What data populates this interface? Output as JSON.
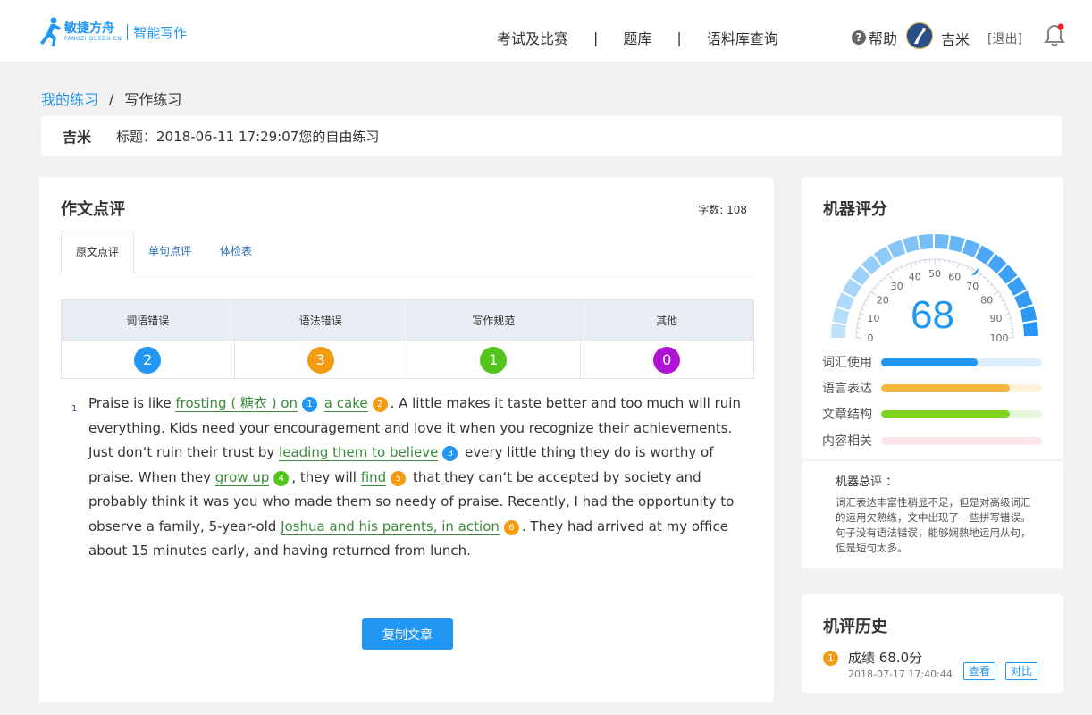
{
  "header": {
    "logo_cn": "敏捷方舟",
    "logo_en": "FANGZHOUEDU.CN",
    "product": "智能写作",
    "nav": [
      "考试及比赛",
      "题库",
      "语料库查询"
    ],
    "nav_divider": "|",
    "help": "帮助",
    "user": "吉米",
    "logout": "[退出]"
  },
  "breadcrumb": {
    "parent": "我的练习",
    "sep": "/",
    "current": "写作练习"
  },
  "title_bar": {
    "user": "吉米",
    "title": "标题：2018-06-11 17:29:07您的自由练习"
  },
  "review": {
    "heading": "作文点评",
    "word_count": "字数: 108",
    "tabs": [
      "原文点评",
      "单句点评",
      "体检表"
    ],
    "copy_button": "复制文章"
  },
  "errors": [
    {
      "label": "词语错误",
      "count": "2",
      "color": "#2196f3"
    },
    {
      "label": "语法错误",
      "count": "3",
      "color": "#f39c12"
    },
    {
      "label": "写作规范",
      "count": "1",
      "color": "#52c41a"
    },
    {
      "label": "其他",
      "count": "0",
      "color": "#b212d6"
    }
  ],
  "essay": {
    "para_num": "1",
    "segments": [
      {
        "t": "Praise is like "
      },
      {
        "t": "frosting ( 糖衣 ) on",
        "hl": true
      },
      {
        "n": "1",
        "c": "#2196f3"
      },
      {
        "t": " "
      },
      {
        "t": "a cake",
        "hl": true
      },
      {
        "n": "2",
        "c": "#f39c12"
      },
      {
        "t": ". A little makes it taste better and too much will ruin everything. Kids need your encouragement and love it when you recognize their achievements. Just don‘t ruin their trust by "
      },
      {
        "t": "leading them to believe",
        "hl": true
      },
      {
        "n": "3",
        "c": "#2196f3"
      },
      {
        "t": " every little thing they do is worthy of praise. When they "
      },
      {
        "t": "grow up",
        "hl": true
      },
      {
        "n": "4",
        "c": "#52c41a"
      },
      {
        "t": ", they will "
      },
      {
        "t": "find",
        "hl": true
      },
      {
        "n": "5",
        "c": "#f39c12"
      },
      {
        "t": " that they can‘t be accepted by society and probably think it was you who made them so needy of praise. Recently, I had the opportunity to observe a family, 5-year-old "
      },
      {
        "t": "Joshua and his parents, in action",
        "hl": true
      },
      {
        "n": "6",
        "c": "#f39c12"
      },
      {
        "t": ". They had arrived at my office about 15 minutes early, and having returned from lunch."
      }
    ]
  },
  "score": {
    "heading": "机器评分",
    "value": "68",
    "gauge_ticks": [
      "0",
      "10",
      "20",
      "30",
      "40",
      "50",
      "60",
      "70",
      "80",
      "90",
      "100"
    ],
    "metrics": [
      {
        "label": "词汇使用",
        "fill": 0.6,
        "color": "#2196f3",
        "track": "#dcedfb"
      },
      {
        "label": "语言表达",
        "fill": 0.8,
        "color": "#f4b73d",
        "track": "#fdf1d9"
      },
      {
        "label": "文章结构",
        "fill": 0.8,
        "color": "#7ed321",
        "track": "#e7f6dc"
      },
      {
        "label": "内容相关",
        "fill": 0.0,
        "color": "#f7a6b0",
        "track": "#fde4e7"
      }
    ]
  },
  "comment": {
    "title": "机器总评 ：",
    "body": "词汇表达丰富性稍显不足，但是对高级词汇的运用欠熟练，文中出现了一些拼写错误。句子没有语法错误，能够娴熟地运用从句，但是短句太多。"
  },
  "history": {
    "heading": "机评历史",
    "index": "1",
    "score": "成绩 68.0分",
    "time": "2018-07-17 17:40:44",
    "view": "查看",
    "compare": "对比"
  }
}
